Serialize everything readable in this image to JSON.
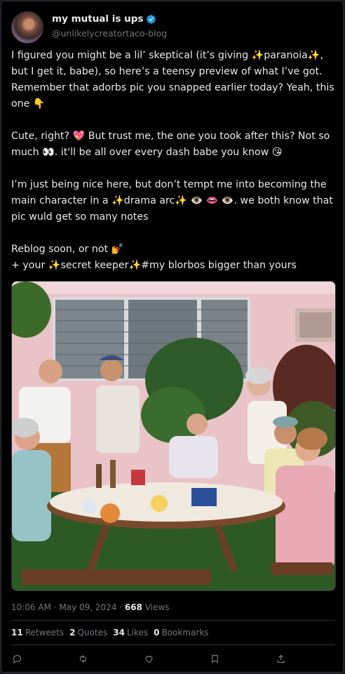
{
  "post": {
    "display_name": "my mutual is ups",
    "handle": "@unlikelycreatortaco-blog",
    "paragraphs": [
      "I figured you might be a lil’ skeptical (it’s giving ✨paranoia✨, but I get it, babe), so here’s a teensy preview of what I’ve got. Remember that adorbs pic you snapped earlier today? Yeah, this one 👇",
      "Cute, right? 💖 But trust me, the one you took after this? Not so much 👀. it'll be all over every dash babe you know 😘",
      "I’m just being nice here, but don’t tempt me into becoming the main character in a ✨drama arc✨ 👁️ 👄 👁️. we both know that pic wuld get so many notes",
      "Reblog soon, or not 💅\n+ your ✨secret keeper✨#my blorbos bigger than yours"
    ],
    "timestamp": "10:06 AM · May 09, 2024",
    "views_count": "668",
    "views_label": "Views",
    "retweets_count": "11",
    "retweets_label": "Retweets",
    "quotes_count": "2",
    "quotes_label": "Quotes",
    "likes_count": "34",
    "likes_label": "Likes",
    "bookmarks_count": "0",
    "bookmarks_label": "Bookmarks"
  },
  "icons": [
    "verified-icon",
    "reply-icon",
    "retweet-icon",
    "like-icon",
    "bookmark-icon",
    "share-icon"
  ],
  "colors": {
    "background": "#000000",
    "text": "#e7e9ea",
    "muted": "#71767b",
    "border": "#2f3336",
    "verified": "#1d9bf0"
  }
}
